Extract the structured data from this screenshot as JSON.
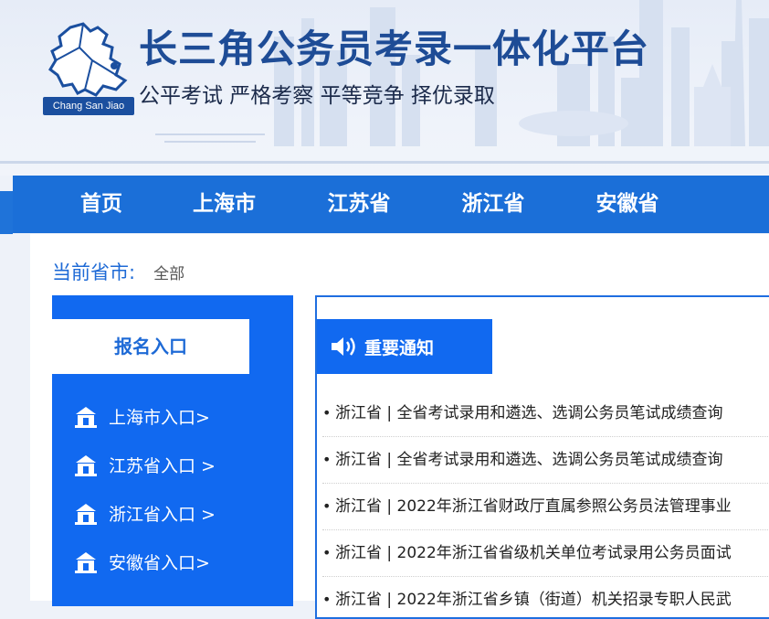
{
  "header": {
    "logo_badge": "Chang San Jiao",
    "title": "长三角公务员考录一体化平台",
    "slogan": "公平考试 严格考察 平等竞争 择优录取"
  },
  "nav": {
    "items": [
      {
        "label": "首页"
      },
      {
        "label": "上海市"
      },
      {
        "label": "江苏省"
      },
      {
        "label": "浙江省"
      },
      {
        "label": "安徽省"
      }
    ]
  },
  "province": {
    "label": "当前省市:",
    "value": "全部"
  },
  "registration": {
    "tab_label": "报名入口",
    "entries": [
      {
        "label": "上海市入口>"
      },
      {
        "label": "江苏省入口 >"
      },
      {
        "label": "浙江省入口 >"
      },
      {
        "label": "安徽省入口>"
      }
    ]
  },
  "notices": {
    "tab_label": "重要通知",
    "items": [
      {
        "text": "浙江省 | 全省考试录用和遴选、选调公务员笔试成绩查询"
      },
      {
        "text": "浙江省 | 全省考试录用和遴选、选调公务员笔试成绩查询"
      },
      {
        "text": "浙江省 | 2022年浙江省财政厅直属参照公务员法管理事业"
      },
      {
        "text": "浙江省 | 2022年浙江省省级机关单位考试录用公务员面试"
      },
      {
        "text": "浙江省 | 2022年浙江省乡镇（街道）机关招录专职人民武"
      }
    ]
  },
  "colors": {
    "brand_blue": "#1169f0",
    "nav_blue": "#1b6fd8",
    "title_blue": "#1e4c96"
  },
  "icons": {
    "logo": "yangtze-delta-map-icon",
    "entry": "building-icon",
    "notice": "speaker-icon"
  }
}
